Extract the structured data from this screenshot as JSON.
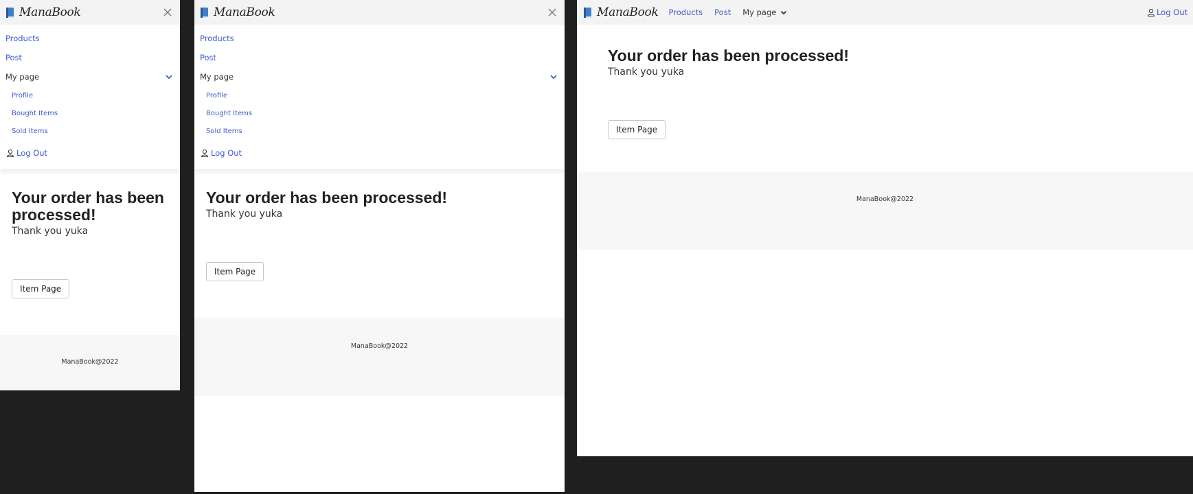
{
  "brand": {
    "name": "ManaBook",
    "accent": "#3b5bcc"
  },
  "nav": {
    "products": "Products",
    "post": "Post",
    "my_page": "My page",
    "profile": "Profile",
    "bought_items": "Bought Items",
    "sold_items": "Sold Items",
    "logout": "Log Out"
  },
  "main": {
    "heading": "Your order has been processed!",
    "thanks": "Thank you yuka",
    "item_page_button": "Item Page"
  },
  "footer": {
    "copyright": "ManaBook@2022"
  },
  "icons": {
    "brand": "book-icon",
    "close": "close-icon",
    "dropdown": "chevron-down-icon",
    "user": "user-icon"
  }
}
